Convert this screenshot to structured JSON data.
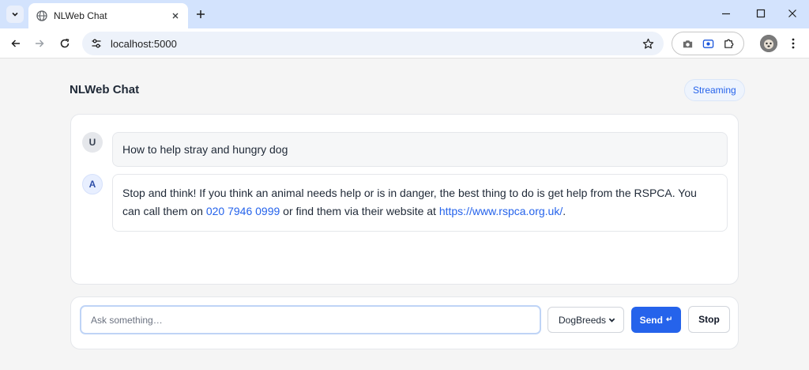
{
  "browser": {
    "tab_title": "NLWeb Chat",
    "url": "localhost:5000"
  },
  "page": {
    "title": "NLWeb Chat",
    "mode_badge": "Streaming"
  },
  "messages": [
    {
      "role_initial": "U",
      "text": "How to help stray and hungry dog"
    },
    {
      "role_initial": "A",
      "text_before_phone": "Stop and think! If you think an animal needs help or is in danger, the best thing to do is get help from the RSPCA. You can call them on ",
      "phone": "020 7946 0999",
      "text_middle": " or find them via their website at ",
      "website": "https://www.rspca.org.uk/",
      "text_end": "."
    }
  ],
  "composer": {
    "placeholder": "Ask something…",
    "site_selected": "DogBreeds",
    "send_label": "Send",
    "send_glyph": "↵",
    "stop_label": "Stop"
  },
  "colors": {
    "accent": "#2563eb",
    "tabstrip": "#d3e3fd",
    "page_background": "#f5f5f5"
  }
}
